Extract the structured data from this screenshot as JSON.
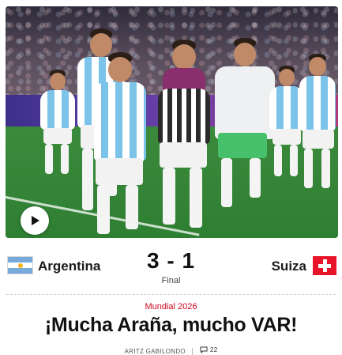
{
  "media": {
    "play_icon": "play-icon"
  },
  "match": {
    "home": {
      "name": "Argentina",
      "flag": "argentina-flag"
    },
    "away": {
      "name": "Suiza",
      "flag": "switzerland-flag"
    },
    "score": "3 - 1",
    "status": "Final"
  },
  "article": {
    "kicker": "Mundial 2026",
    "headline": "¡Mucha Araña, mucho VAR!",
    "author": "ARITZ GABILONDO",
    "comments_count": "22",
    "comment_icon": "comment-icon"
  },
  "colors": {
    "kicker": "#d0021b",
    "argentina_blue": "#75aadb",
    "swiss_red": "#e8152a"
  }
}
